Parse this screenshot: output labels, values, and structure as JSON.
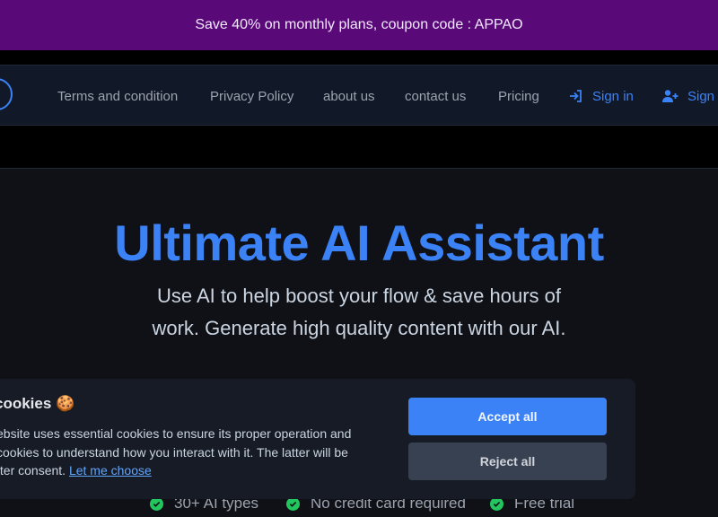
{
  "promo": {
    "text": "Save 40% on monthly plans, coupon code : APPAO"
  },
  "nav": {
    "links": [
      "Terms and condition",
      "Privacy Policy",
      "about us",
      "contact us",
      "Pricing"
    ],
    "sign_in": "Sign in",
    "sign_up": "Sign"
  },
  "hero": {
    "title": "Ultimate AI Assistant",
    "subtitle": "Use AI to help boost your flow & save hours of work. Generate high quality content with our AI."
  },
  "features": [
    "30+ AI types",
    "No credit card required",
    "Free trial"
  ],
  "cookie": {
    "title": "cookies",
    "emoji": "🍪",
    "line1": "ebsite uses essential cookies to ensure its proper operation and",
    "line2": "cookies to understand how you interact with it. The latter will be",
    "line3": "fter consent.",
    "link": "Let me choose",
    "accept": "Accept all",
    "reject": "Reject all"
  },
  "colors": {
    "accent": "#3b82f6",
    "promo_bg": "#5a0a78",
    "background": "#0f1117",
    "check": "#22c55e"
  }
}
